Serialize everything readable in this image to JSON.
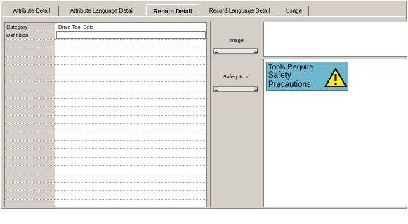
{
  "tabs": [
    {
      "label": "Attribute Detail",
      "active": false
    },
    {
      "label": "Attribute Language Detail",
      "active": false
    },
    {
      "label": "Record Detail",
      "active": true
    },
    {
      "label": "Record Language Detail",
      "active": false
    },
    {
      "label": "Usage",
      "active": false
    }
  ],
  "grid": {
    "rows": [
      {
        "label": "Category",
        "value": "Drive Tool Sets"
      },
      {
        "label": "Definition",
        "value": ""
      }
    ]
  },
  "right": {
    "image_caption": "Image",
    "safety_icon_caption": "Safety Icon",
    "safety_sign": {
      "line1": "Tools Require",
      "line2": "Safety",
      "line3": "Precautions",
      "background_color": "#6fb6cf",
      "warning_icon": "warning-triangle"
    }
  }
}
